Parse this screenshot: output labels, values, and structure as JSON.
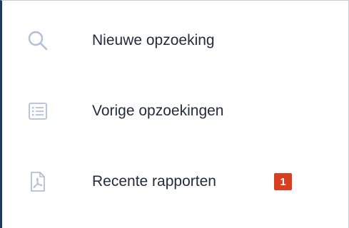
{
  "menu": {
    "items": [
      {
        "label": "Nieuwe opzoeking",
        "icon": "search-icon"
      },
      {
        "label": "Vorige opzoekingen",
        "icon": "list-icon"
      },
      {
        "label": "Recente rapporten",
        "icon": "pdf-document-icon",
        "badge": "1"
      }
    ]
  },
  "colors": {
    "icon": "#b3bfd3",
    "text": "#232c3a",
    "badge": "#d93f1f",
    "accent_border": "#1f3a5f"
  }
}
